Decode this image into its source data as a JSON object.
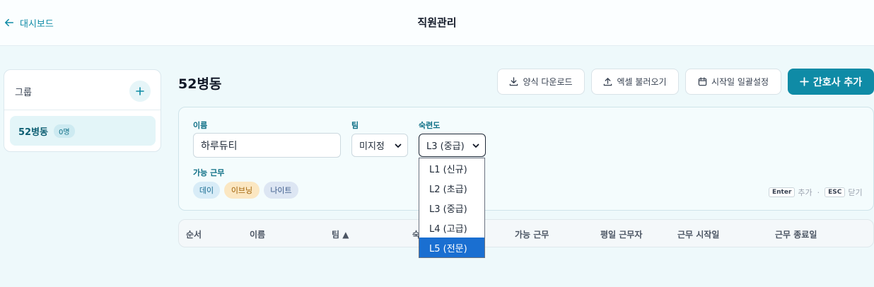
{
  "header": {
    "back_label": "대시보드",
    "title": "직원관리"
  },
  "sidebar": {
    "title": "그룹",
    "add_icon": "plus-icon",
    "groups": [
      {
        "name": "52병동",
        "count": "0명"
      }
    ]
  },
  "main": {
    "ward_title": "52병동",
    "toolbar": {
      "download_label": "양식 다운로드",
      "import_label": "엑셀 불러오기",
      "bulk_start_label": "시작일 일괄설정",
      "add_nurse_label": "간호사 추가"
    }
  },
  "form": {
    "name_label": "이름",
    "name_value": "하루듀티",
    "team_label": "팀",
    "team_value": "미지정",
    "skill_label": "숙련도",
    "skill_value": "L3 (중급)",
    "shifts_label": "가능 근무",
    "shifts": [
      {
        "label": "데이",
        "color": "#d8ecf7"
      },
      {
        "label": "이브닝",
        "color": "#fbe7c2"
      },
      {
        "label": "나이트",
        "color": "#dde6f3"
      }
    ],
    "hint": {
      "enter_key": "Enter",
      "enter_action": "추가",
      "separator": "·",
      "esc_key": "ESC",
      "esc_action": "닫기"
    }
  },
  "table": {
    "columns": [
      "순서",
      "이름",
      "팀 ▲",
      "숙",
      "가능 근무",
      "평일 근무자",
      "근무 시작일",
      "근무 종료일"
    ]
  },
  "skill_dropdown": {
    "options": [
      "L1 (신규)",
      "L2 (초급)",
      "L3 (중급)",
      "L4 (고급)",
      "L5 (전문)"
    ],
    "highlighted": "L5 (전문)"
  },
  "colors": {
    "accent": "#0f8ba6",
    "page_bg": "#eef9fb",
    "dropdown_highlight": "#1a6fd1"
  }
}
